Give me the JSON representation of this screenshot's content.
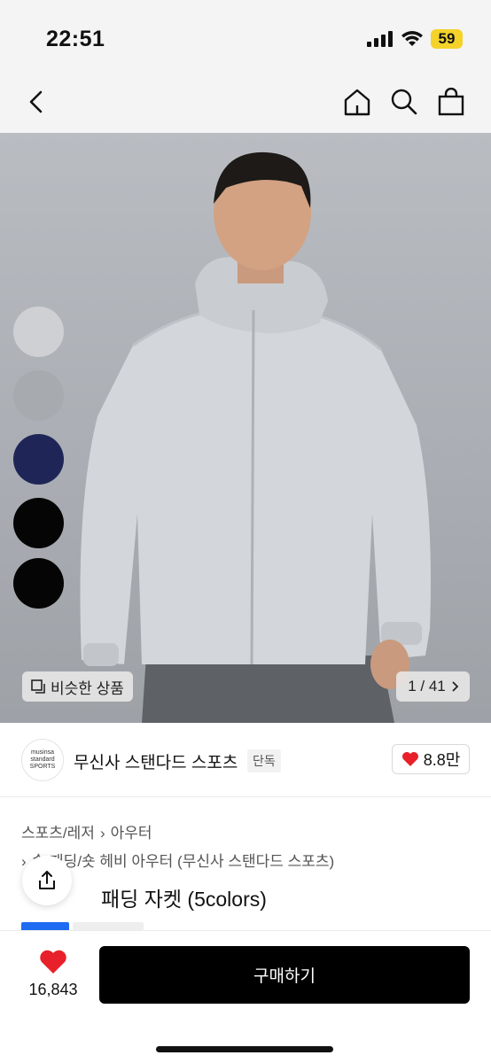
{
  "status_bar": {
    "time": "22:51",
    "battery": "59",
    "battery_color": "#f4d22a"
  },
  "nav": {
    "back_icon": "chevron-left-icon",
    "home_icon": "home-icon",
    "search_icon": "search-icon",
    "cart_icon": "shopping-bag-icon"
  },
  "hero": {
    "swatches": [
      {
        "color": "#cfd0d3"
      },
      {
        "color": "#a7aaae"
      },
      {
        "color": "#1f2657"
      },
      {
        "color": "#050505"
      },
      {
        "color": "#050505"
      }
    ],
    "similar_label": "비슷한 상품",
    "counter": "1 / 41"
  },
  "brand": {
    "logo_lines": [
      "musinsa",
      "standard",
      "SPORTS"
    ],
    "name": "무신사 스탠다드 스포츠",
    "tag": "단독",
    "likes": "8.8만"
  },
  "breadcrumb": {
    "category": "스포츠/레저",
    "subcategory": "아우터"
  },
  "product": {
    "sub_category_line": "숏 패딩/숏 헤비 아우터 (무신사 스탠다드 스포츠)",
    "title": "패딩 자켓 (5colors)"
  },
  "bottom_bar": {
    "wish_count": "16,843",
    "buy_label": "구매하기",
    "accent_red": "#e8202a"
  }
}
